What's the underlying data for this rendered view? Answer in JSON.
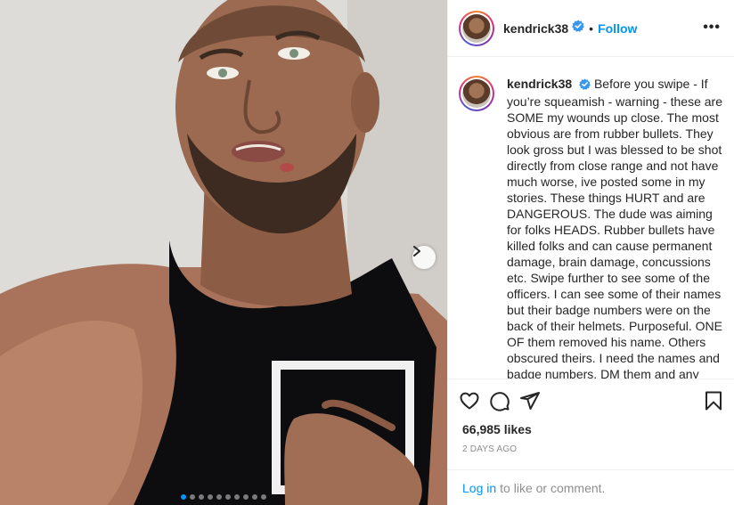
{
  "post": {
    "username": "kendrick38",
    "follow_label": "Follow",
    "header_separator": "•",
    "more_label": "•••",
    "caption": "Before you swipe - If you’re squeamish - warning - these are SOME my wounds up close. The most obvious are from rubber bullets. They look gross but I was blessed to be shot directly from close range and not have much worse, ive posted some in my stories. These things HURT and are DANGEROUS. The dude was aiming for folks HEADS. Rubber bullets have killed folks and can cause permanent damage, brain damage, concussions etc. Swipe further to see some of the officers. I can see some of their names but their badge numbers were on the back of their helmets. Purposeful. ONE OF them removed his name. Others obscured theirs. I need the names and badge numbers. DM them and any",
    "likes": "66,985 likes",
    "timestamp": "2 DAYS AGO",
    "login_link": "Log in",
    "login_text": "to like or comment."
  },
  "carousel": {
    "total_slides": 10,
    "current_slide": 1
  },
  "icons": {
    "like": "heart-icon",
    "comment": "comment-icon",
    "share": "paper-plane-icon",
    "save": "bookmark-icon",
    "verified": "verified-badge-icon",
    "next": "chevron-right-icon"
  },
  "colors": {
    "accent": "#0095f6",
    "text": "#262626",
    "muted": "#8e8e8e",
    "border": "#efefef"
  }
}
